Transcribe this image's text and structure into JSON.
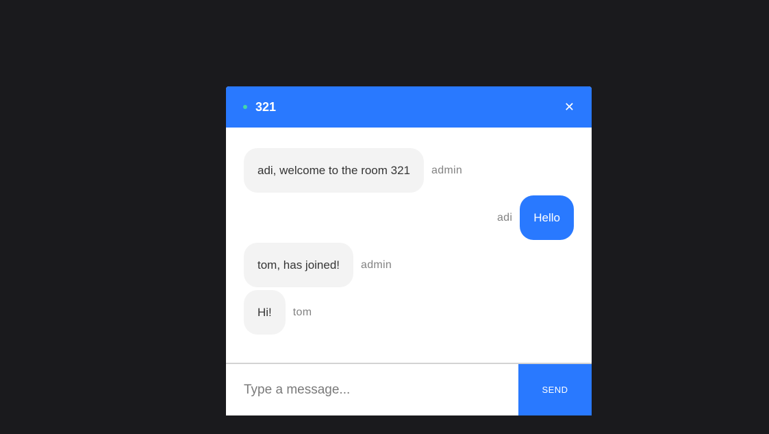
{
  "header": {
    "room_name": "321",
    "close_symbol": "✕",
    "status_color": "#44d7a8",
    "accent_color": "#2979ff"
  },
  "messages": [
    {
      "text": "adi, welcome to the room 321",
      "sender": "admin",
      "direction": "received"
    },
    {
      "text": "Hello",
      "sender": "adi",
      "direction": "sent"
    },
    {
      "text": "tom, has joined!",
      "sender": "admin",
      "direction": "received"
    },
    {
      "text": "Hi!",
      "sender": "tom",
      "direction": "received"
    }
  ],
  "composer": {
    "placeholder": "Type a message...",
    "value": "",
    "send_label": "SEND"
  }
}
